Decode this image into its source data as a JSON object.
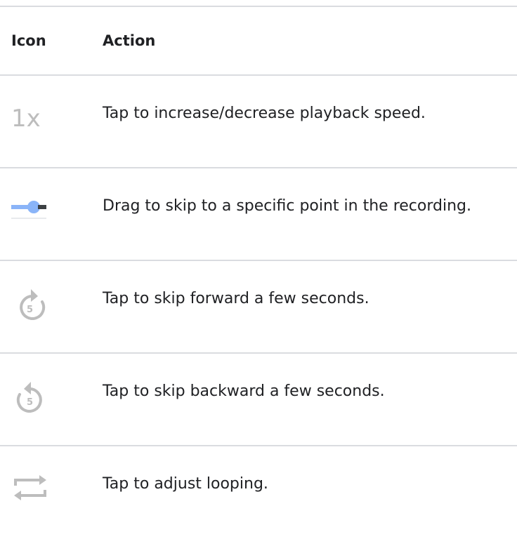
{
  "table": {
    "headers": {
      "icon": "Icon",
      "action": "Action"
    },
    "rows": [
      {
        "icon": "playback-speed-1x-icon",
        "action": "Tap to increase/decrease playback speed."
      },
      {
        "icon": "seek-slider-icon",
        "action": "Drag to skip to a specific point in the recording."
      },
      {
        "icon": "skip-forward-5-icon",
        "action": "Tap to skip forward a few seconds."
      },
      {
        "icon": "skip-backward-5-icon",
        "action": "Tap to skip backward a few seconds."
      },
      {
        "icon": "loop-icon",
        "action": "Tap to adjust looping."
      }
    ],
    "icon_labels": {
      "speed": "1x",
      "skip_seconds": "5"
    }
  },
  "colors": {
    "rule": "#dadce0",
    "text": "#202124",
    "icon_gray": "#bdbdbd",
    "slider_blue": "#8ab4f8",
    "slider_dark": "#3c4043"
  }
}
